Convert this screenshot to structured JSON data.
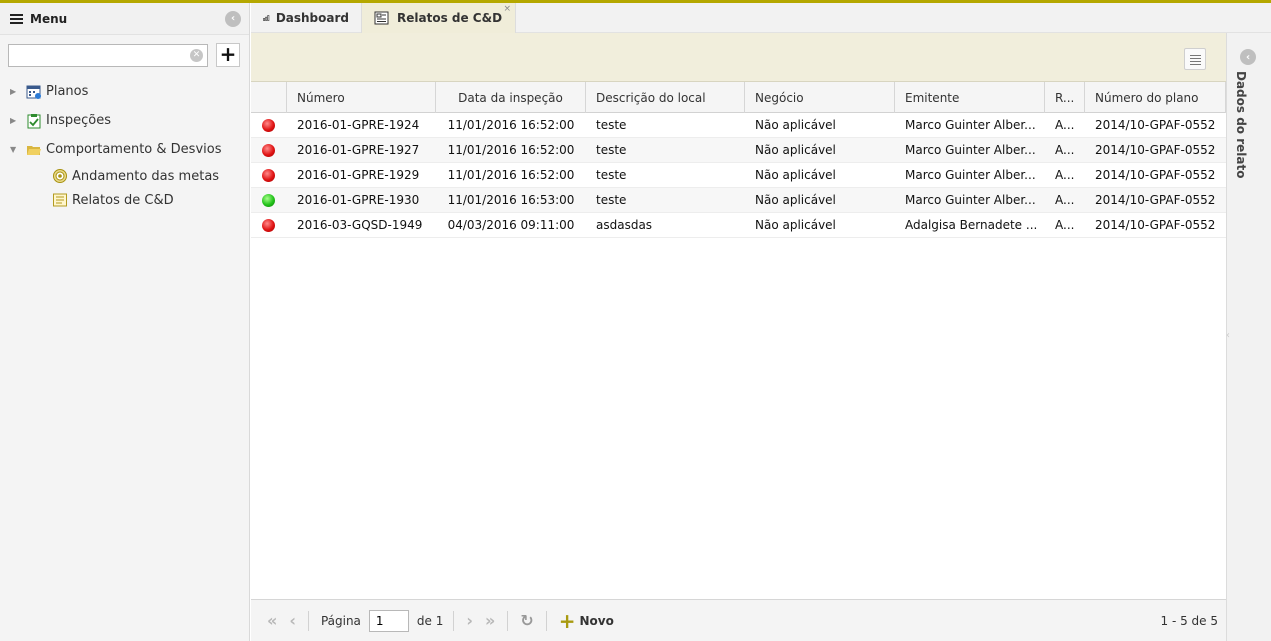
{
  "sidebar": {
    "title": "Menu",
    "search": {
      "value": "",
      "placeholder": ""
    },
    "add_label": "+",
    "tree": [
      {
        "label": "Planos",
        "expanded": false,
        "icon": "calendar-icon"
      },
      {
        "label": "Inspeções",
        "expanded": false,
        "icon": "clipboard-check-icon"
      },
      {
        "label": "Comportamento & Desvios",
        "expanded": true,
        "icon": "folder-open-icon",
        "children": [
          {
            "label": "Andamento das metas",
            "icon": "target-icon"
          },
          {
            "label": "Relatos de C&D",
            "icon": "report-icon"
          }
        ]
      }
    ]
  },
  "tabs": [
    {
      "label": "Dashboard",
      "icon": "bar-chart-icon",
      "active": false
    },
    {
      "label": "Relatos de C&D",
      "icon": "report-icon",
      "active": true,
      "close": "×"
    }
  ],
  "grid": {
    "columns": [
      "",
      "Número",
      "Data da inspeção",
      "Descrição do local",
      "Negócio",
      "Emitente",
      "R...",
      "Número do plano"
    ],
    "rows": [
      {
        "status": "red",
        "numero": "2016-01-GPRE-1924",
        "data": "11/01/2016 16:52:00",
        "descricao": "teste",
        "negocio": "Não aplicável",
        "emitente": "Marco Guinter Alber...",
        "r": "A...",
        "plano": "2014/10-GPAF-0552"
      },
      {
        "status": "red",
        "numero": "2016-01-GPRE-1927",
        "data": "11/01/2016 16:52:00",
        "descricao": "teste",
        "negocio": "Não aplicável",
        "emitente": "Marco Guinter Alber...",
        "r": "A...",
        "plano": "2014/10-GPAF-0552"
      },
      {
        "status": "red",
        "numero": "2016-01-GPRE-1929",
        "data": "11/01/2016 16:52:00",
        "descricao": "teste",
        "negocio": "Não aplicável",
        "emitente": "Marco Guinter Alber...",
        "r": "A...",
        "plano": "2014/10-GPAF-0552"
      },
      {
        "status": "green",
        "numero": "2016-01-GPRE-1930",
        "data": "11/01/2016 16:53:00",
        "descricao": "teste",
        "negocio": "Não aplicável",
        "emitente": "Marco Guinter Alber...",
        "r": "A...",
        "plano": "2014/10-GPAF-0552"
      },
      {
        "status": "red",
        "numero": "2016-03-GQSD-1949",
        "data": "04/03/2016 09:11:00",
        "descricao": "asdasdas",
        "negocio": "Não aplicável",
        "emitente": "Adalgisa Bernadete ...",
        "r": "A...",
        "plano": "2014/10-GPAF-0552"
      }
    ]
  },
  "pager": {
    "page_label": "Página",
    "page_value": "1",
    "of_label": "de 1",
    "new_label": "Novo",
    "info": "1 - 5 de 5"
  },
  "right_panel": {
    "title": "Dados do relato"
  },
  "colors": {
    "accent": "#b5a800",
    "toolbar_bg": "#f1eedc",
    "status_red": "#e01313",
    "status_green": "#22c21a"
  }
}
